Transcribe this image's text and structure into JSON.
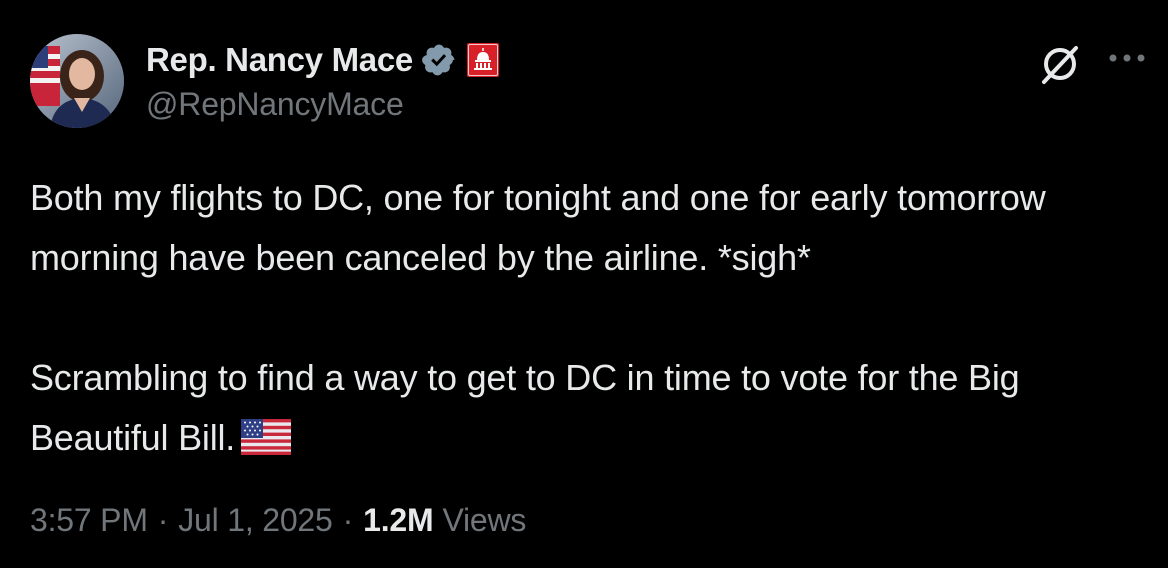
{
  "author": {
    "display_name": "Rep. Nancy Mace",
    "handle": "@RepNancyMace",
    "avatar_icon": "profile-photo",
    "verified_color": "#829aab",
    "affiliation_badge_color": "#d72027"
  },
  "tweet": {
    "paragraphs": [
      "Both my flights to DC, one for tonight and one for early tomorrow morning have been canceled by the airline. *sigh*",
      "Scrambling to find a way to get to DC in time to vote for the Big Beautiful Bill."
    ],
    "trailing_emoji": "us-flag-icon"
  },
  "meta": {
    "time": "3:57 PM",
    "separator": "·",
    "date": "Jul 1, 2025",
    "views_count": "1.2M",
    "views_label": "Views"
  },
  "actions": {
    "grok_icon": "grok-icon",
    "more_icon": "more-icon"
  }
}
